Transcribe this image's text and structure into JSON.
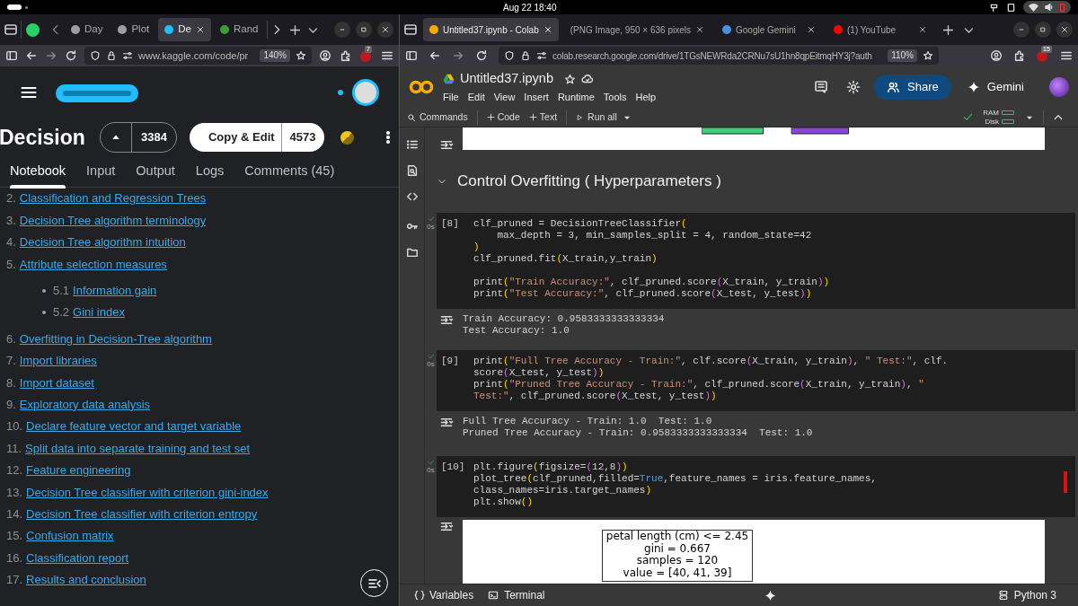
{
  "system_bar": {
    "clock": "Aug 22  18:40"
  },
  "left_browser": {
    "tabs": [
      {
        "label": "Day",
        "color": "#9aa0a6",
        "selected": false
      },
      {
        "label": "Plot",
        "color": "#9aa0a6",
        "selected": false
      },
      {
        "label": "De",
        "color": "#20beff",
        "selected": true
      },
      {
        "label": "Rand",
        "color": "#3f9c35",
        "selected": false
      }
    ],
    "url": "www.kaggle.com/code/pr",
    "zoom": "140%",
    "extension_badge": "7"
  },
  "kaggle": {
    "title": "Decision",
    "votes": "3384",
    "copy_edit": "Copy & Edit",
    "copies": "4573",
    "tabs": [
      {
        "label": "Notebook",
        "selected": true
      },
      {
        "label": "Input",
        "selected": false
      },
      {
        "label": "Output",
        "selected": false
      },
      {
        "label": "Logs",
        "selected": false
      },
      {
        "label": "Comments (45)",
        "selected": false
      }
    ],
    "toc": [
      {
        "number": "2.",
        "title": "Classification and Regression Trees"
      },
      {
        "number": "3.",
        "title": "Decision Tree algorithm terminology"
      },
      {
        "number": "4.",
        "title": "Decision Tree algorithm intuition"
      },
      {
        "number": "5.",
        "title": "Attribute selection measures",
        "children": [
          {
            "number": "5.1",
            "title": "Information gain"
          },
          {
            "number": "5.2",
            "title": "Gini index"
          }
        ]
      },
      {
        "number": "6.",
        "title": "Overfitting in Decision-Tree algorithm"
      },
      {
        "number": "7.",
        "title": "Import libraries"
      },
      {
        "number": "8.",
        "title": "Import dataset"
      },
      {
        "number": "9.",
        "title": "Exploratory data analysis"
      },
      {
        "number": "10.",
        "title": "Declare feature vector and target variable"
      },
      {
        "number": "11.",
        "title": "Split data into separate training and test set"
      },
      {
        "number": "12.",
        "title": "Feature engineering"
      },
      {
        "number": "13.",
        "title": "Decision Tree classifier with criterion gini-index"
      },
      {
        "number": "14.",
        "title": "Decision Tree classifier with criterion entropy"
      },
      {
        "number": "15.",
        "title": "Confusion matrix"
      },
      {
        "number": "16.",
        "title": "Classification report"
      },
      {
        "number": "17.",
        "title": "Results and conclusion"
      }
    ]
  },
  "right_browser": {
    "tabs": [
      {
        "label": "Untitled37.ipynb - Colab",
        "color": "#f9ab00",
        "selected": true
      },
      {
        "label": "(PNG Image, 950 × 636 pixels",
        "selected": false
      },
      {
        "label": "Google Gemini",
        "color": "#4a90e2",
        "selected": false
      },
      {
        "label": "(1) YouTube",
        "color": "#ff0000",
        "selected": false
      }
    ],
    "url": "colab.research.google.com/drive/1TGsNEWRda2CRNu7sU1hn8qpEitmqHY3j?auth",
    "zoom": "110%",
    "extension_badge": "15"
  },
  "colab": {
    "notebook_name": "Untitled37.ipynb",
    "menu": [
      "File",
      "Edit",
      "View",
      "Insert",
      "Runtime",
      "Tools",
      "Help"
    ],
    "share": "Share",
    "gemini": "Gemini",
    "toolbar": {
      "commands": "Commands",
      "add_code": "Code",
      "add_text": "Text",
      "run_all": "Run all",
      "ram": "RAM",
      "disk": "Disk"
    },
    "section_heading": "Control Overfitting ( Hyperparameters )",
    "cells": [
      {
        "count": "[8]",
        "time": "0s",
        "code": [
          [
            "clf_pruned = DecisionTreeClassifier(",
            "    max_depth = 3, min_samples_split = 4, random_state=42",
            ")",
            "clf_pruned.fit(X_train,y_train)"
          ],
          [
            "print(\"Train Accuracy:\", clf_pruned.score(X_train, y_train))",
            "print(\"Test Accuracy:\", clf_pruned.score(X_test, y_test))"
          ]
        ],
        "output": [
          "Train Accuracy: 0.9583333333333334",
          "Test Accuracy: 1.0"
        ]
      },
      {
        "count": "[9]",
        "time": "0s",
        "code": [
          [
            "print(\"Full Tree Accuracy - Train:\", clf.score(X_train, y_train), \" Test:\", clf.",
            "score(X_test, y_test))",
            "print(\"Pruned Tree Accuracy - Train:\", clf_pruned.score(X_train, y_train), \"",
            "Test:\", clf_pruned.score(X_test, y_test))"
          ]
        ],
        "output": [
          "Full Tree Accuracy - Train: 1.0  Test: 1.0",
          "Pruned Tree Accuracy - Train: 0.9583333333333334  Test: 1.0"
        ]
      },
      {
        "count": "[10]",
        "time": "0s",
        "code": [
          [
            "plt.figure(figsize=(12,8))",
            "plot_tree(clf_pruned,filled=True,feature_names = iris.feature_names,",
            "class_names=iris.target_names)",
            "plt.show()"
          ]
        ],
        "plot_node": [
          "petal length (cm) <= 2.45",
          "gini = 0.667",
          "samples = 120",
          "value = [40, 41, 39]"
        ]
      }
    ],
    "bottom_bar": {
      "variables": "Variables",
      "terminal": "Terminal",
      "runtime": "Python 3"
    }
  }
}
